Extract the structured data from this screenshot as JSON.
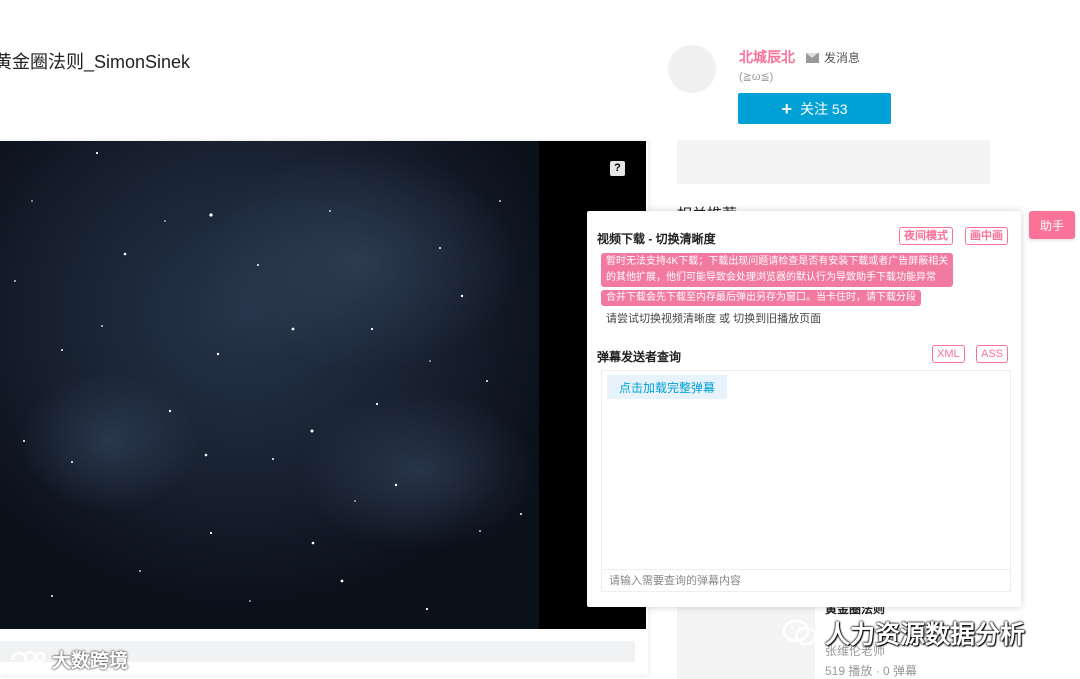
{
  "video": {
    "title": "黄金圈法则_SimonSinek"
  },
  "uploader": {
    "name": "北城辰北",
    "message_label": "发消息",
    "signature": "(≧ω≦)",
    "follow_label": "关注 53"
  },
  "related": {
    "title": "相关推荐",
    "item": {
      "title": "黄金圈法则",
      "author": "张维伦老师",
      "stats": "519 播放 · 0 弹幕"
    }
  },
  "helper": {
    "toggle_label": "助手",
    "download_heading": "视频下载 - 切换清晰度",
    "night_mode_label": "夜间模式",
    "pip_label": "画中画",
    "warning_1_line_1": "暂时无法支持4K下载；下载出现问题请检查是否有安装下载或者广告屏蔽相关",
    "warning_1_line_2": "的其他扩展，他们可能导致会处理浏览器的默认行为导致助手下载功能异常",
    "warning_2": "合并下载会先下载至内存最后弹出另存为窗口。当卡住时，请下载分段",
    "hint": "请尝试切换视频清晰度 或 切换到旧播放页面",
    "danmaku_heading": "弹幕发送者查询",
    "xml_label": "XML",
    "ass_label": "ASS",
    "load_button": "点击加载完整弹幕",
    "query_placeholder": "请输入需要查询的弹幕内容"
  },
  "player": {
    "help_icon_glyph": "?"
  },
  "watermarks": {
    "left_text": "大数跨境",
    "right_text": "人力资源数据分析"
  },
  "colors": {
    "accent_pink": "#fb7299",
    "accent_blue": "#00a1d6",
    "warning_bg": "#f27aa0"
  }
}
